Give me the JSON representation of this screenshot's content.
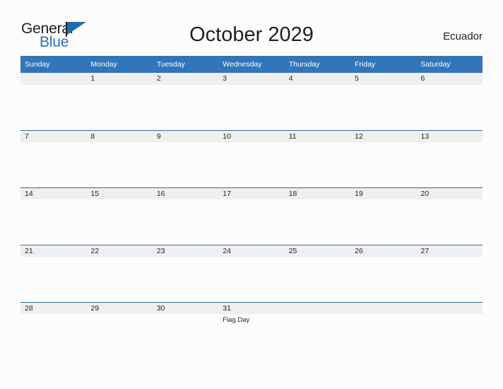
{
  "brand": {
    "name_part1": "General",
    "name_part2": "Blue",
    "flag_icon": "flag-icon",
    "accent_color": "#2a72b5"
  },
  "header": {
    "title": "October 2029",
    "country": "Ecuador"
  },
  "calendar": {
    "header_bg": "#3275b8",
    "band_bg": "#efefef",
    "band_border": "#2e6da4",
    "weekdays": [
      "Sunday",
      "Monday",
      "Tuesday",
      "Wednesday",
      "Thursday",
      "Friday",
      "Saturday"
    ],
    "weeks": [
      [
        {
          "day": "",
          "events": []
        },
        {
          "day": "1",
          "events": []
        },
        {
          "day": "2",
          "events": []
        },
        {
          "day": "3",
          "events": []
        },
        {
          "day": "4",
          "events": []
        },
        {
          "day": "5",
          "events": []
        },
        {
          "day": "6",
          "events": []
        }
      ],
      [
        {
          "day": "7",
          "events": []
        },
        {
          "day": "8",
          "events": []
        },
        {
          "day": "9",
          "events": []
        },
        {
          "day": "10",
          "events": []
        },
        {
          "day": "11",
          "events": []
        },
        {
          "day": "12",
          "events": []
        },
        {
          "day": "13",
          "events": []
        }
      ],
      [
        {
          "day": "14",
          "events": []
        },
        {
          "day": "15",
          "events": []
        },
        {
          "day": "16",
          "events": []
        },
        {
          "day": "17",
          "events": []
        },
        {
          "day": "18",
          "events": []
        },
        {
          "day": "19",
          "events": []
        },
        {
          "day": "20",
          "events": []
        }
      ],
      [
        {
          "day": "21",
          "events": []
        },
        {
          "day": "22",
          "events": []
        },
        {
          "day": "23",
          "events": []
        },
        {
          "day": "24",
          "events": []
        },
        {
          "day": "25",
          "events": []
        },
        {
          "day": "26",
          "events": []
        },
        {
          "day": "27",
          "events": []
        }
      ],
      [
        {
          "day": "28",
          "events": []
        },
        {
          "day": "29",
          "events": []
        },
        {
          "day": "30",
          "events": []
        },
        {
          "day": "31",
          "events": [
            "Flag Day"
          ]
        },
        {
          "day": "",
          "events": []
        },
        {
          "day": "",
          "events": []
        },
        {
          "day": "",
          "events": []
        }
      ]
    ]
  }
}
